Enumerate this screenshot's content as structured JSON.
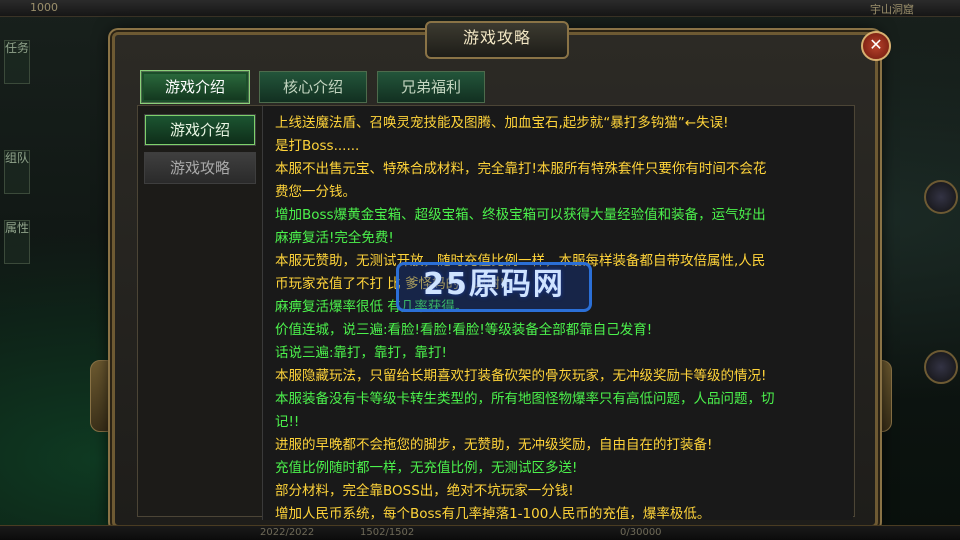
{
  "hud": {
    "top_stats": [
      "1000",
      "",
      ""
    ],
    "top_right_map": "宇山洞窟",
    "left_tabs": [
      "任务",
      "组队",
      "属性"
    ],
    "bottom": [
      "2022/2022",
      "1502/1502",
      "",
      "",
      "0/30000"
    ]
  },
  "dialog": {
    "title": "游戏攻略",
    "close_icon": "close-icon",
    "top_tabs": [
      {
        "label": "游戏介绍",
        "active": true
      },
      {
        "label": "核心介绍",
        "active": false
      },
      {
        "label": "兄弟福利",
        "active": false
      }
    ],
    "side_tabs": [
      {
        "label": "游戏介绍",
        "active": true
      },
      {
        "label": "游戏攻略",
        "active": false
      }
    ],
    "lines": [
      {
        "color": "y",
        "text": "上线送魔法盾、召唤灵宠技能及图腾、加血宝石,起步就“暴打多钩猫”←失误!"
      },
      {
        "color": "y",
        "text": "是打Boss......"
      },
      {
        "color": "y",
        "text": "本服不出售元宝、特殊合成材料，完全靠打!本服所有特殊套件只要你有时间不会花"
      },
      {
        "color": "y",
        "text": "费您一分钱。"
      },
      {
        "color": "g",
        "text": "增加Boss爆黄金宝箱、超级宝箱、终极宝箱可以获得大量经验值和装备，运气好出"
      },
      {
        "color": "g",
        "text": "麻痹复活!完全免费!"
      },
      {
        "color": "y",
        "text": "本服无赞助，无测试开放，随时充值比例一样，本服每样装备都自带攻倍属性,人民"
      },
      {
        "color": "y",
        "text": "币玩家充值了不打          比          爹怪妈的，谢谢!!"
      },
      {
        "color": "g",
        "text": "麻痹复活爆率很低          有几率获得。"
      },
      {
        "color": "g",
        "text": "价值连城，说三遍:看脸!看脸!看脸!等级装备全部都靠自己发育!"
      },
      {
        "color": "g",
        "text": "话说三遍:靠打，靠打，靠打!"
      },
      {
        "color": "y",
        "text": "本服隐藏玩法，只留给长期喜欢打装备砍架的骨灰玩家，无冲级奖励卡等级的情况!"
      },
      {
        "color": "g",
        "text": "本服装备没有卡等级卡转生类型的，所有地图怪物爆率只有高低问题，人品问题，切"
      },
      {
        "color": "g",
        "text": "记!!"
      },
      {
        "color": "y",
        "text": "进服的早晚都不会拖您的脚步，无赞助，无冲级奖励，自由自在的打装备!"
      },
      {
        "color": "g",
        "text": "充值比例随时都一样，无充值比例，无测试区多送!"
      },
      {
        "color": "y",
        "text": "部分材料，完全靠BOSS出，绝对不坑玩家一分钱!"
      },
      {
        "color": "y",
        "text": "增加人民币系统，每个Boss有几率掉落1-100人民币的充值，爆率极低。"
      }
    ]
  },
  "watermark": {
    "text": "25原码网"
  },
  "colors": {
    "yellow": "#ffd43a",
    "green": "#4cf24c",
    "tab_green": "#2b6b3d",
    "frame_gold": "#8a7346"
  }
}
